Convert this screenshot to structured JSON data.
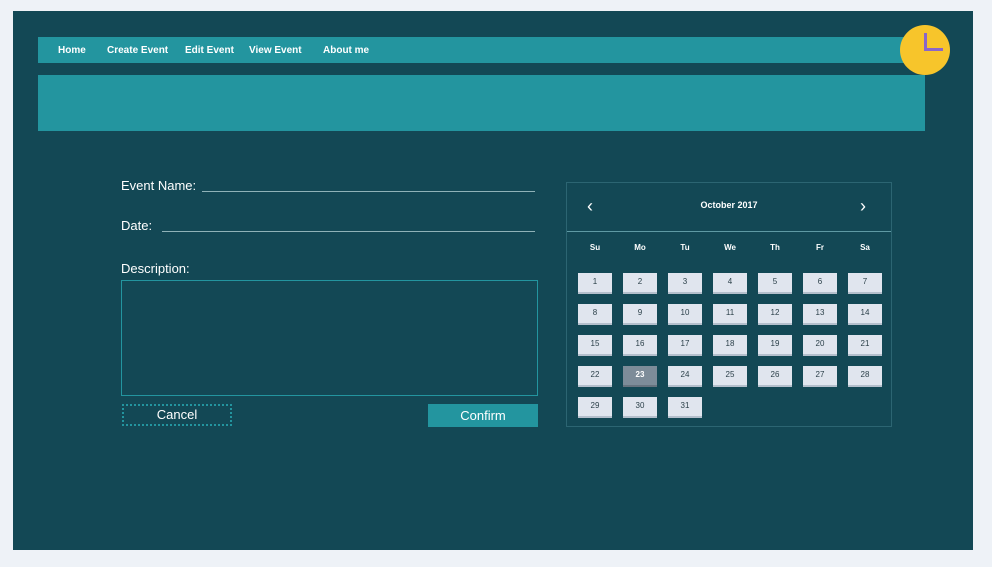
{
  "nav": {
    "items": [
      "Home",
      "Create Event",
      "Edit Event",
      "View Event",
      "About me"
    ]
  },
  "form": {
    "event_name_label": "Event Name:",
    "date_label": "Date:",
    "description_label": "Description:",
    "event_name_value": "",
    "date_value": "",
    "description_value": "",
    "cancel_label": "Cancel",
    "confirm_label": "Confirm"
  },
  "calendar": {
    "title": "October 2017",
    "prev_icon": "chevron-left-icon",
    "next_icon": "chevron-right-icon",
    "prev_glyph": "‹",
    "next_glyph": "›",
    "weekdays": [
      "Su",
      "Mo",
      "Tu",
      "We",
      "Th",
      "Fr",
      "Sa"
    ],
    "days": [
      "1",
      "2",
      "3",
      "4",
      "5",
      "6",
      "7",
      "8",
      "9",
      "10",
      "11",
      "12",
      "13",
      "14",
      "15",
      "16",
      "17",
      "18",
      "19",
      "20",
      "21",
      "22",
      "23",
      "24",
      "25",
      "26",
      "27",
      "28",
      "29",
      "30",
      "31"
    ],
    "selected_day": "23"
  },
  "colors": {
    "background": "#134855",
    "accent": "#23959f",
    "clock": "#f7c52b",
    "clock_hands": "#8a66c9",
    "day_cell": "#e0e5ee",
    "day_selected": "#7d8c99"
  },
  "icons": {
    "clock": "clock-icon"
  }
}
